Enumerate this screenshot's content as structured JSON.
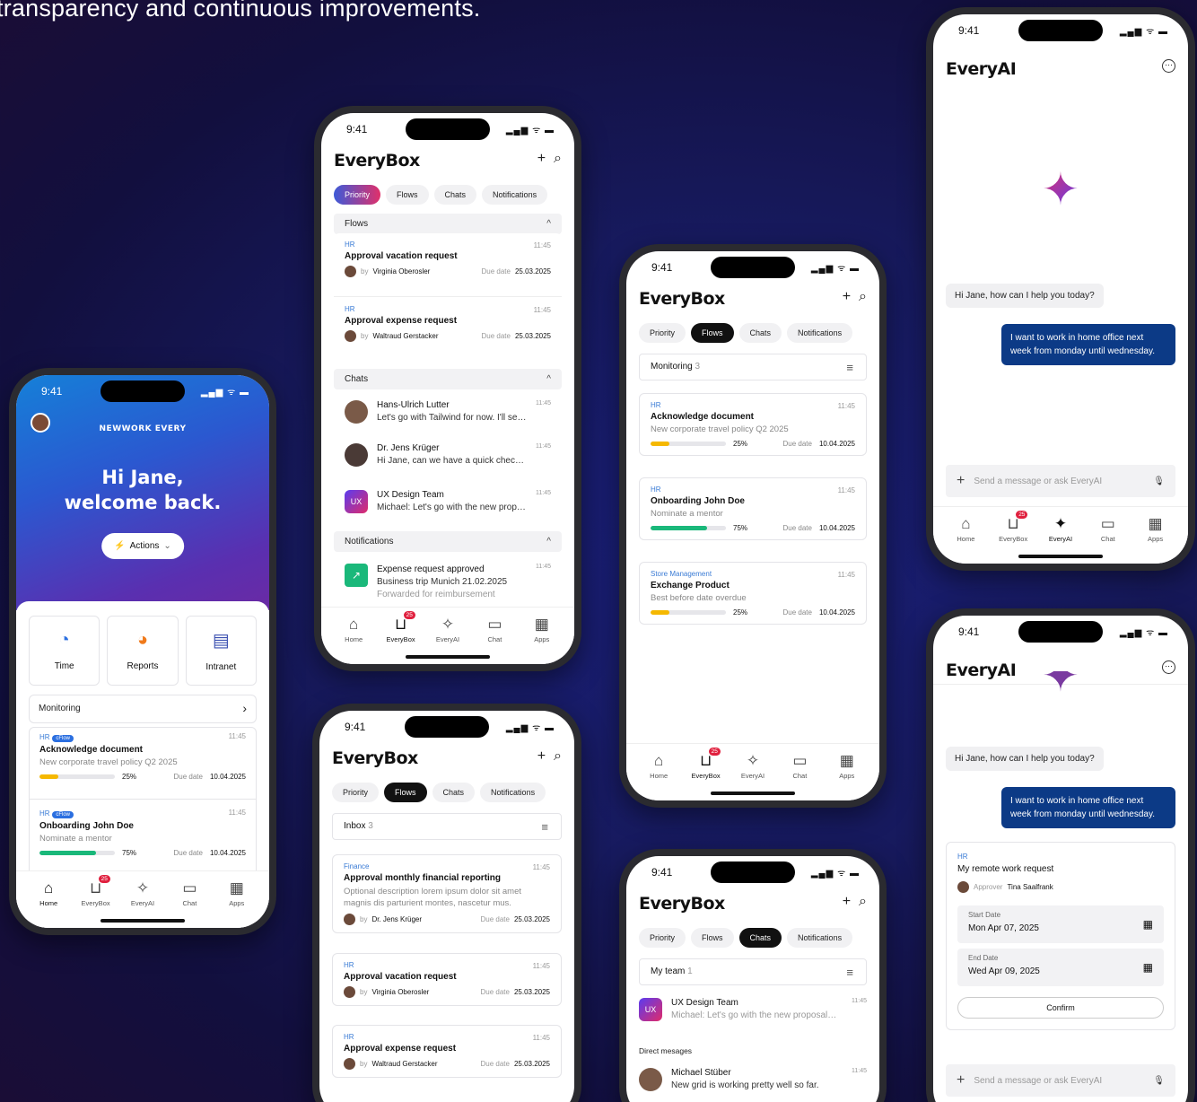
{
  "headline": "transparency and continuous improvements.",
  "status_time": "9:41",
  "status_icons": "▂▄▆ ᯤ ▬",
  "app_title": "EveryBox",
  "ai_title": "EveryAI",
  "icons": {
    "plus": "+",
    "search": "⌕",
    "more": "⋯",
    "filter": "≡",
    "chev_up": "^",
    "chev_right": "›",
    "chev_down": "⌄"
  },
  "chips": {
    "priority": "Priority",
    "flows": "Flows",
    "chats": "Chats",
    "notifications": "Notifications"
  },
  "tabs": {
    "home": "Home",
    "everybox": "EveryBox",
    "everyai": "EveryAI",
    "chat": "Chat",
    "apps": "Apps",
    "badge": "25"
  },
  "home": {
    "brand": "NEWWORK EVERY",
    "greeting1": "Hi Jane,",
    "greeting2": "welcome back.",
    "actions": "Actions",
    "tiles": [
      "Time",
      "Reports",
      "Intranet"
    ],
    "monitoring": "Monitoring",
    "cards": [
      {
        "tag": "HR",
        "flowtag": "cFlow",
        "time": "11:45",
        "title": "Acknowledge document",
        "sub": "New corporate travel policy Q2 2025",
        "pct": 25,
        "pct_label": "25%",
        "due_label": "Due date",
        "due": "10.04.2025"
      },
      {
        "tag": "HR",
        "flowtag": "cFlow",
        "time": "11:45",
        "title": "Onboarding John Doe",
        "sub": "Nominate a mentor",
        "pct": 75,
        "pct_label": "75%",
        "due_label": "Due date",
        "due": "10.04.2025"
      }
    ]
  },
  "p2": {
    "flows": "Flows",
    "cards": [
      {
        "tag": "HR",
        "time": "11:45",
        "title": "Approval vacation request",
        "by": "by",
        "person": "Virginia Oberosler",
        "due_label": "Due date",
        "due": "25.03.2025"
      },
      {
        "tag": "HR",
        "time": "11:45",
        "title": "Approval expense request",
        "by": "by",
        "person": "Waltraud Gerstacker",
        "due_label": "Due date",
        "due": "25.03.2025"
      }
    ],
    "chats": "Chats",
    "chatlist": [
      {
        "name": "Hans-Ulrich Lutter",
        "msg": "Let's go with Tailwind for now. I'll set up…",
        "time": "11:45"
      },
      {
        "name": "Dr. Jens Krüger",
        "msg": "Hi Jane, can we have a quick check-in…",
        "time": "11:45"
      },
      {
        "name": "UX Design Team",
        "msg": "Michael: Let's go with the new proposal…",
        "time": "11:45",
        "av": "UX"
      }
    ],
    "notifications": "Notifications",
    "notif": {
      "title": "Expense request approved",
      "line1": "Business trip Munich 21.02.2025",
      "line2": "Forwarded for reimbursement",
      "time": "11:45"
    }
  },
  "p3": {
    "inbox": "Inbox",
    "inbox_count": "3",
    "cards": [
      {
        "tag": "Finance",
        "time": "11:45",
        "title": "Approval monthly financial reporting",
        "sub": "Optional description lorem ipsum dolor sit amet magnis dis parturient montes, nascetur mus.",
        "by": "by",
        "person": "Dr. Jens Krüger",
        "due_label": "Due date",
        "due": "25.03.2025"
      },
      {
        "tag": "HR",
        "time": "11:45",
        "title": "Approval vacation request",
        "by": "by",
        "person": "Virginia Oberosler",
        "due_label": "Due date",
        "due": "25.03.2025"
      },
      {
        "tag": "HR",
        "time": "11:45",
        "title": "Approval expense request",
        "by": "by",
        "person": "Waltraud Gerstacker",
        "due_label": "Due date",
        "due": "25.03.2025"
      }
    ]
  },
  "p4": {
    "monitoring": "Monitoring",
    "count": "3",
    "cards": [
      {
        "tag": "HR",
        "time": "11:45",
        "title": "Acknowledge document",
        "sub": "New corporate travel policy Q2 2025",
        "pct": 25,
        "pct_label": "25%",
        "due_label": "Due date",
        "due": "10.04.2025",
        "color": "#f5b800"
      },
      {
        "tag": "HR",
        "time": "11:45",
        "title": "Onboarding John Doe",
        "sub": "Nominate a mentor",
        "pct": 75,
        "pct_label": "75%",
        "due_label": "Due date",
        "due": "10.04.2025",
        "color": "#1ab87a"
      },
      {
        "tag": "Store Management",
        "time": "11:45",
        "title": "Exchange Product",
        "sub": "Best before date overdue",
        "pct": 25,
        "pct_label": "25%",
        "due_label": "Due date",
        "due": "10.04.2025",
        "color": "#f5b800"
      }
    ]
  },
  "p5": {
    "myteam": "My team",
    "count": "1",
    "team": {
      "name": "UX Design Team",
      "msg": "Michael: Let's go with the new proposal…",
      "time": "11:45",
      "av": "UX"
    },
    "direct": "Direct mesages",
    "dm": {
      "name": "Michael Stüber",
      "msg": "New grid is working pretty well so far.",
      "time": "11:45"
    }
  },
  "ai": {
    "ai_greeting": "Hi Jane, how can I help you today?",
    "user_msg": "I want to work in home office next week from monday until wednesday.",
    "placeholder": "Send a message or ask EveryAI",
    "req": {
      "tag": "HR",
      "title": "My remote work request",
      "approver_label": "Approver",
      "approver": "Tina Saalfrank",
      "start_label": "Start Date",
      "start": "Mon Apr 07, 2025",
      "end_label": "End Date",
      "end": "Wed Apr 09, 2025",
      "confirm": "Confirm"
    }
  },
  "colors": {
    "accent_blue": "#0c3a86",
    "badge_red": "#e0203e",
    "progress_yellow": "#f5b800",
    "progress_green": "#1ab87a"
  }
}
